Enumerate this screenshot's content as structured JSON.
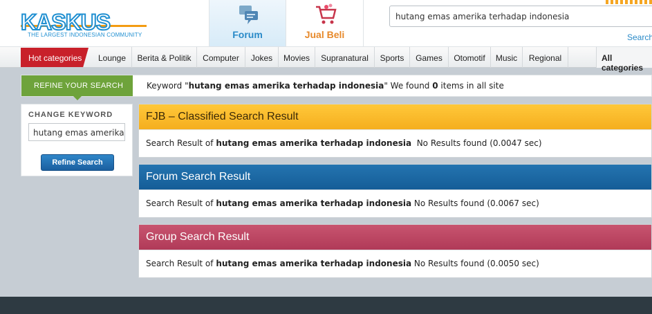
{
  "header": {
    "logo": {
      "text": "KASKUS",
      "tagline": "THE LARGEST INDONESIAN COMMUNITY"
    },
    "tabs": [
      {
        "label": "Forum",
        "icon": "forum-icon"
      },
      {
        "label": "Jual Beli",
        "icon": "shopping-cart-icon"
      }
    ],
    "search": {
      "value": "hutang emas amerika terhadap indonesia",
      "link": "Search"
    }
  },
  "categories": {
    "hot": "Hot categories",
    "items": [
      "Lounge",
      "Berita & Politik",
      "Computer",
      "Jokes",
      "Movies",
      "Supranatural",
      "Sports",
      "Games",
      "Otomotif",
      "Music",
      "Regional"
    ],
    "all": "All categories"
  },
  "refine": {
    "button": "REFINE YOUR SEARCH",
    "keyword_prefix": "Keyword \"",
    "keyword": "hutang emas amerika terhadap indonesia",
    "keyword_mid": "\" We found ",
    "count": "0",
    "keyword_suffix": " items in all site"
  },
  "sidebar": {
    "title": "CHANGE KEYWORD",
    "input_value": "hutang emas amerika",
    "button": "Refine Search"
  },
  "results": [
    {
      "title": "FJB – Classified Search Result",
      "prefix": "Search Result of ",
      "keyword": "hutang emas amerika terhadap indonesia",
      "status": "No Results found (0.0047 sec)"
    },
    {
      "title": "Forum Search Result",
      "prefix": "Search Result of ",
      "keyword": "hutang emas amerika terhadap indonesia",
      "status": "No Results found (0.0067 sec)"
    },
    {
      "title": "Group Search Result",
      "prefix": "Search Result of ",
      "keyword": "hutang emas amerika terhadap indonesia",
      "status": "No Results found (0.0050 sec)"
    }
  ],
  "colors": {
    "brand_blue": "#1f8fd1",
    "hot_red": "#c8202a",
    "refine_green": "#6ea33b",
    "fjb_yellow": "#ffc83a",
    "forum_blue": "#1b6aa6",
    "group_pink": "#b03a58"
  }
}
